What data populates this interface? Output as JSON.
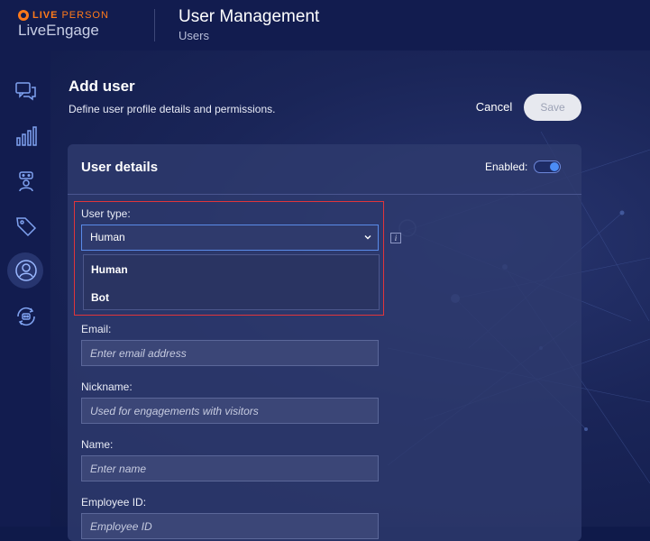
{
  "brand": {
    "name_part1": "LIVE",
    "name_part2": "PERSON",
    "product": "LiveEngage"
  },
  "header": {
    "title": "User Management",
    "subtitle": "Users"
  },
  "sidebar": {
    "items": [
      {
        "name": "messaging",
        "icon": "chat-bubbles-icon",
        "active": false
      },
      {
        "name": "analytics",
        "icon": "bar-chart-icon",
        "active": false
      },
      {
        "name": "bots",
        "icon": "bot-icon",
        "active": false
      },
      {
        "name": "campaigns",
        "icon": "tag-icon",
        "active": false
      },
      {
        "name": "users",
        "icon": "user-circle-icon",
        "active": true
      },
      {
        "name": "automation",
        "icon": "refresh-bot-icon",
        "active": false
      }
    ]
  },
  "page": {
    "title": "Add user",
    "description": "Define user profile details and permissions.",
    "cancel_label": "Cancel",
    "save_label": "Save"
  },
  "card": {
    "title": "User details",
    "enabled_label": "Enabled:",
    "enabled": true
  },
  "form": {
    "user_type": {
      "label": "User type:",
      "value": "Human",
      "options": [
        "Human",
        "Bot"
      ]
    },
    "email": {
      "label": "Email:",
      "placeholder": "Enter email address"
    },
    "nickname": {
      "label": "Nickname:",
      "placeholder": "Used for engagements with visitors"
    },
    "name": {
      "label": "Name:",
      "placeholder": "Enter name"
    },
    "employee_id": {
      "label": "Employee ID:",
      "placeholder": "Employee ID"
    }
  },
  "colors": {
    "accent": "#4c8df6",
    "brand": "#ff7a1a",
    "highlight": "#e0353b"
  }
}
